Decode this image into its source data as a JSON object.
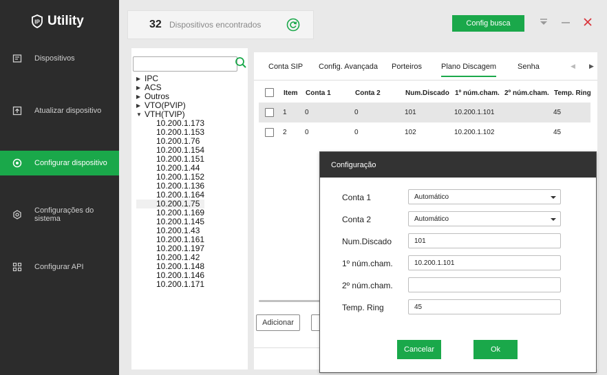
{
  "app": {
    "title": "Utility"
  },
  "sidebar": {
    "items": [
      {
        "label": "Dispositivos",
        "icon": "device-list-icon",
        "active": false
      },
      {
        "label": "Atualizar dispositivo",
        "icon": "upload-icon",
        "active": false
      },
      {
        "label": "Configurar dispositivo",
        "icon": "target-icon",
        "active": true
      },
      {
        "label": "Configurações do sistema",
        "icon": "gear-icon",
        "active": false
      },
      {
        "label": "Configurar API",
        "icon": "api-grid-icon",
        "active": false
      }
    ]
  },
  "header": {
    "device_count": "32",
    "device_count_label": "Dispositivos encontrados",
    "search_config_button": "Config busca"
  },
  "tree": {
    "search_placeholder": "",
    "groups": [
      {
        "label": "IPC",
        "expanded": false
      },
      {
        "label": "ACS",
        "expanded": false
      },
      {
        "label": "Outros",
        "expanded": false
      },
      {
        "label": "VTO(PVIP)",
        "expanded": false
      },
      {
        "label": "VTH(TVIP)",
        "expanded": true
      }
    ],
    "vth_devices": [
      "10.200.1.173",
      "10.200.1.153",
      "10.200.1.76",
      "10.200.1.154",
      "10.200.1.151",
      "10.200.1.44",
      "10.200.1.152",
      "10.200.1.136",
      "10.200.1.164",
      "10.200.1.75",
      "10.200.1.169",
      "10.200.1.145",
      "10.200.1.43",
      "10.200.1.161",
      "10.200.1.197",
      "10.200.1.42",
      "10.200.1.148",
      "10.200.1.146",
      "10.200.1.171"
    ],
    "selected_device": "10.200.1.75"
  },
  "tabs": [
    {
      "label": "Conta SIP",
      "active": false
    },
    {
      "label": "Config. Avançada",
      "active": false
    },
    {
      "label": "Porteiros",
      "active": false
    },
    {
      "label": "Plano Discagem",
      "active": true
    },
    {
      "label": "Senha",
      "active": false
    }
  ],
  "table": {
    "columns": [
      "Item",
      "Conta 1",
      "Conta 2",
      "Num.Discado",
      "1º núm.cham.",
      "2º núm.cham.",
      "Temp. Ring"
    ],
    "rows": [
      {
        "item": "1",
        "conta1": "0",
        "conta2": "0",
        "num_discado": "101",
        "num_cham_1": "10.200.1.101",
        "num_cham_2": "",
        "temp_ring": "45",
        "selected": true
      },
      {
        "item": "2",
        "conta1": "0",
        "conta2": "0",
        "num_discado": "102",
        "num_cham_1": "10.200.1.102",
        "num_cham_2": "",
        "temp_ring": "45",
        "selected": false
      }
    ]
  },
  "actions": {
    "add_button": "Adicionar"
  },
  "dialog": {
    "title": "Configuração",
    "fields": {
      "conta1": {
        "label": "Conta 1",
        "value": "Automático"
      },
      "conta2": {
        "label": "Conta 2",
        "value": "Automático"
      },
      "num_discado": {
        "label": "Num.Discado",
        "value": "101"
      },
      "num_cham_1": {
        "label": "1º núm.cham.",
        "value": "10.200.1.101"
      },
      "num_cham_2": {
        "label": "2º núm.cham.",
        "value": ""
      },
      "temp_ring": {
        "label": "Temp. Ring",
        "value": "45"
      }
    },
    "cancel_button": "Cancelar",
    "ok_button": "Ok"
  },
  "colors": {
    "accent": "#1aa84a",
    "sidebar_bg": "#2c2c2c",
    "dialog_header": "#333333",
    "close_red": "#d9343b"
  }
}
